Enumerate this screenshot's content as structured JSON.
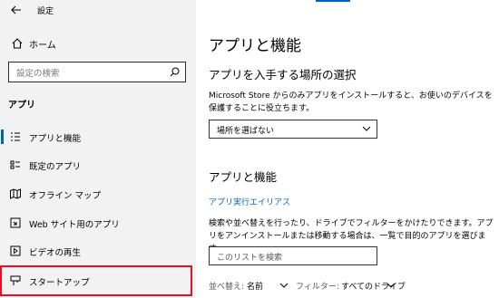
{
  "window": {
    "title": "設定"
  },
  "sidebar": {
    "home_label": "ホーム",
    "search_placeholder": "設定の検索",
    "section_label": "アプリ",
    "items": [
      {
        "label": "アプリと機能",
        "icon": "list-icon",
        "active": true
      },
      {
        "label": "既定のアプリ",
        "icon": "default-apps-icon",
        "active": false
      },
      {
        "label": "オフライン マップ",
        "icon": "map-icon",
        "active": false
      },
      {
        "label": "Web サイト用のアプリ",
        "icon": "web-apps-icon",
        "active": false
      },
      {
        "label": "ビデオの再生",
        "icon": "video-icon",
        "active": false
      },
      {
        "label": "スタートアップ",
        "icon": "startup-icon",
        "active": false
      }
    ]
  },
  "main": {
    "page_title": "アプリと機能",
    "install_heading": "アプリを入手する場所の選択",
    "install_description": "Microsoft Store からのみアプリをインストールすると、お使いのデバイスを保護することに役立ちます。",
    "install_select_value": "場所を選ばない",
    "apps_heading": "アプリと機能",
    "alias_link": "アプリ実行エイリアス",
    "apps_description": "検索や並べ替えを行ったり、ドライブでフィルターをかけたりできます。アプリをアンインストールまたは移動する場合は、一覧で目的のアプリを選びます。",
    "list_search_placeholder": "このリストを検索",
    "sort_label": "並べ替え:",
    "sort_value": "名前",
    "filter_label": "フィルター:",
    "filter_value": "すべてのドライブ"
  },
  "colors": {
    "accent": "#0063b1",
    "link": "#0066b4",
    "highlight_border": "#e81123",
    "sidebar_bg": "#f2f2f2"
  }
}
